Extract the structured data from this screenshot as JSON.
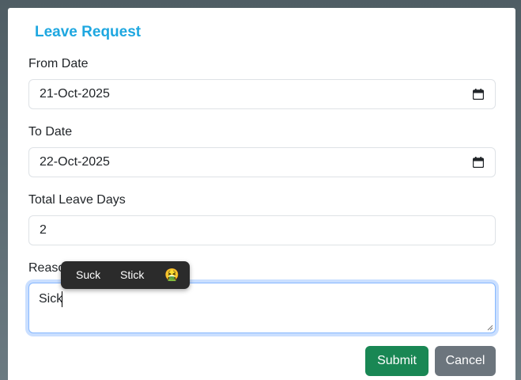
{
  "dialog": {
    "title": "Leave Request"
  },
  "form": {
    "from_date": {
      "label": "From Date",
      "value": "21-Oct-2025"
    },
    "to_date": {
      "label": "To Date",
      "value": "22-Oct-2025"
    },
    "total_days": {
      "label": "Total Leave Days",
      "value": "2"
    },
    "reason": {
      "label": "Reason",
      "value": "Sick"
    }
  },
  "suggestions": {
    "items": [
      "Suck",
      "Stick"
    ],
    "emoji": "🤮"
  },
  "buttons": {
    "submit": "Submit",
    "cancel": "Cancel"
  },
  "colors": {
    "title": "#1ea7e0",
    "submit": "#198754",
    "cancel": "#6c757d",
    "focus_border": "#86b7fe"
  }
}
